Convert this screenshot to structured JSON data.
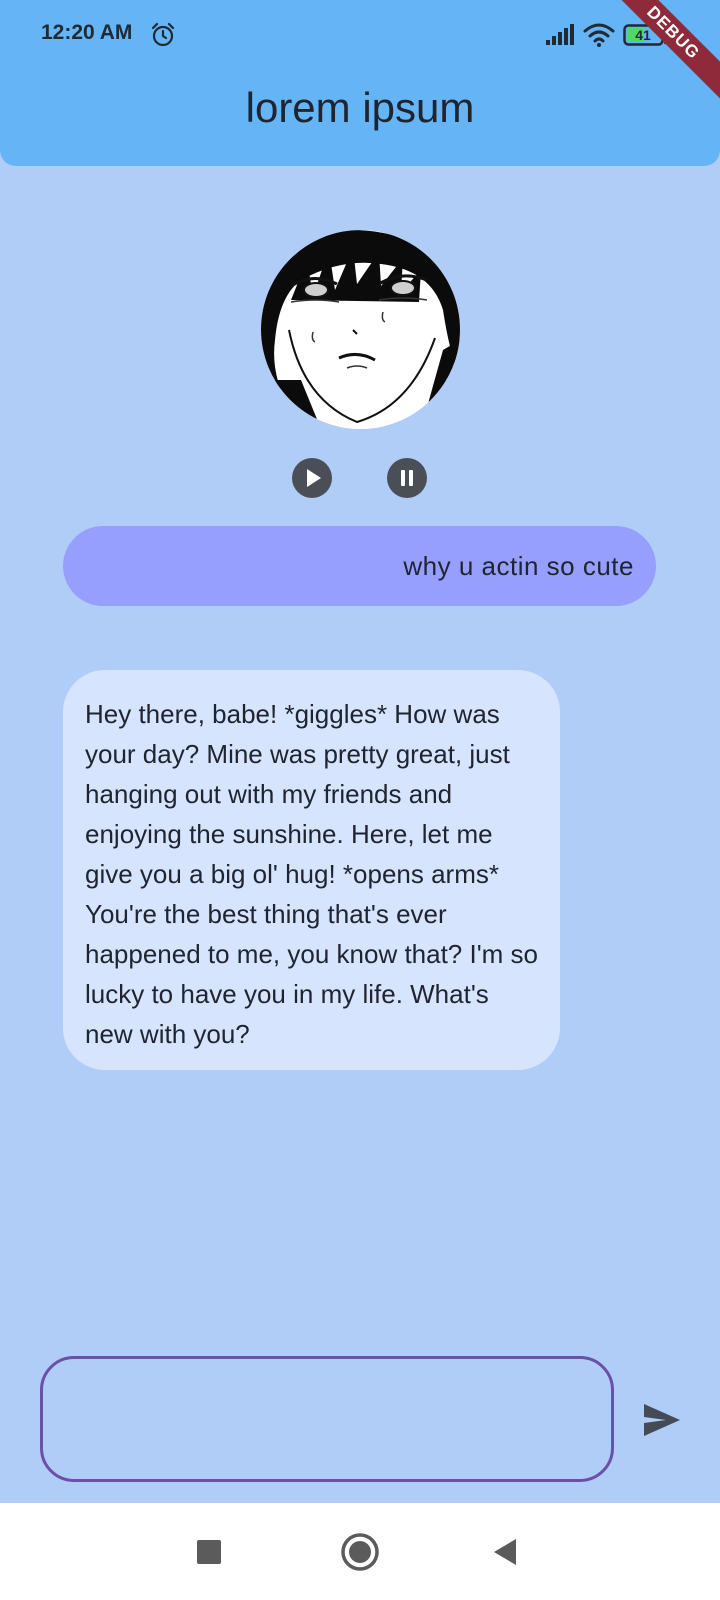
{
  "status_bar": {
    "time": "12:20 AM",
    "alarm_icon": "alarm-clock-icon",
    "signal_icon": "cellular-signal-icon",
    "wifi_icon": "wifi-icon",
    "battery_level": "41",
    "debug_label": "DEBUG"
  },
  "appbar": {
    "title": "lorem ipsum",
    "color": "#64b4f6"
  },
  "player": {
    "play_icon": "play-icon",
    "pause_icon": "pause-icon"
  },
  "messages": [
    {
      "sender": "user",
      "text": "why u actin so cute",
      "color": "#969ffd"
    },
    {
      "sender": "bot",
      "text": "Hey there, babe! *giggles* How was your day? Mine was pretty great, just hanging out with my friends and enjoying the sunshine. Here, let me give you a big ol' hug! *opens arms* You're the best thing that's ever happened to me, you know that? I'm so lucky to have you in my life. What's new with you?",
      "color": "#d6e4fe"
    }
  ],
  "composer": {
    "input_value": "",
    "send_icon": "send-icon",
    "border_color": "#6b50a8"
  },
  "nav": {
    "recents_icon": "square-recents-icon",
    "home_icon": "circle-home-icon",
    "back_icon": "triangle-back-icon"
  },
  "background_color": "#afcdf6"
}
